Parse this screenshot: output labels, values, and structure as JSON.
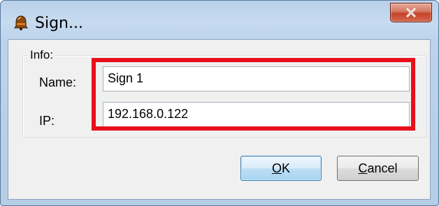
{
  "window": {
    "title": "Sign...",
    "app_icon": "bell-icon",
    "close_icon": "close-icon"
  },
  "info_group": {
    "label": "Info:",
    "name_label": "Name:",
    "name_value": "Sign 1",
    "ip_label": "IP:",
    "ip_value": "192.168.0.122"
  },
  "buttons": {
    "ok_mnemonic": "O",
    "ok_rest": "K",
    "cancel_mnemonic": "C",
    "cancel_rest": "ancel"
  },
  "colors": {
    "highlight": "#e8101a",
    "close_button": "#c5432a"
  }
}
